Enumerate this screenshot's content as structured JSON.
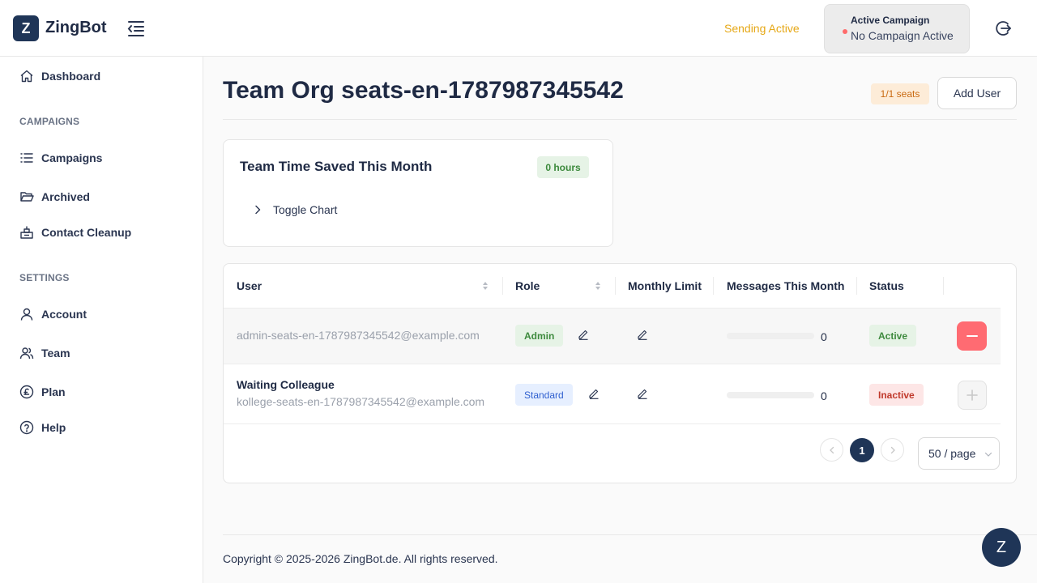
{
  "header": {
    "logo_letter": "Z",
    "app_name": "ZingBot",
    "sending_status": "Sending Active",
    "campaign_title": "Active Campaign",
    "campaign_value": "No Campaign Active"
  },
  "sidebar": {
    "dashboard": "Dashboard",
    "section_campaigns": "CAMPAIGNS",
    "campaigns": "Campaigns",
    "archived": "Archived",
    "contact_cleanup": "Contact Cleanup",
    "section_settings": "SETTINGS",
    "account": "Account",
    "team": "Team",
    "plan": "Plan",
    "help": "Help"
  },
  "page": {
    "title": "Team Org seats-en-1787987345542",
    "seats_badge": "1/1 seats",
    "add_user_label": "Add User"
  },
  "time_card": {
    "title": "Team Time Saved This Month",
    "hours_badge": "0 hours",
    "toggle_label": "Toggle Chart"
  },
  "table": {
    "headers": {
      "user": "User",
      "role": "Role",
      "monthly_limit": "Monthly Limit",
      "messages": "Messages This Month",
      "status": "Status"
    },
    "rows": [
      {
        "name": "",
        "email": "admin-seats-en-1787987345542@example.com",
        "role": "Admin",
        "messages": "0",
        "usage": 0,
        "status": "Active"
      },
      {
        "name": "Waiting Colleague",
        "email": "kollege-seats-en-1787987345542@example.com",
        "role": "Standard",
        "messages": "0",
        "usage": 0,
        "status": "Inactive"
      }
    ]
  },
  "pagination": {
    "current": "1",
    "page_size": "50 / page"
  },
  "footer": {
    "copyright": "Copyright © 2025-2026 ZingBot.de. All rights reserved."
  },
  "chat": {
    "letter": "Z"
  },
  "colors": {
    "brand": "#1f3557",
    "sending": "#e6a817",
    "danger": "#ff6b72"
  }
}
